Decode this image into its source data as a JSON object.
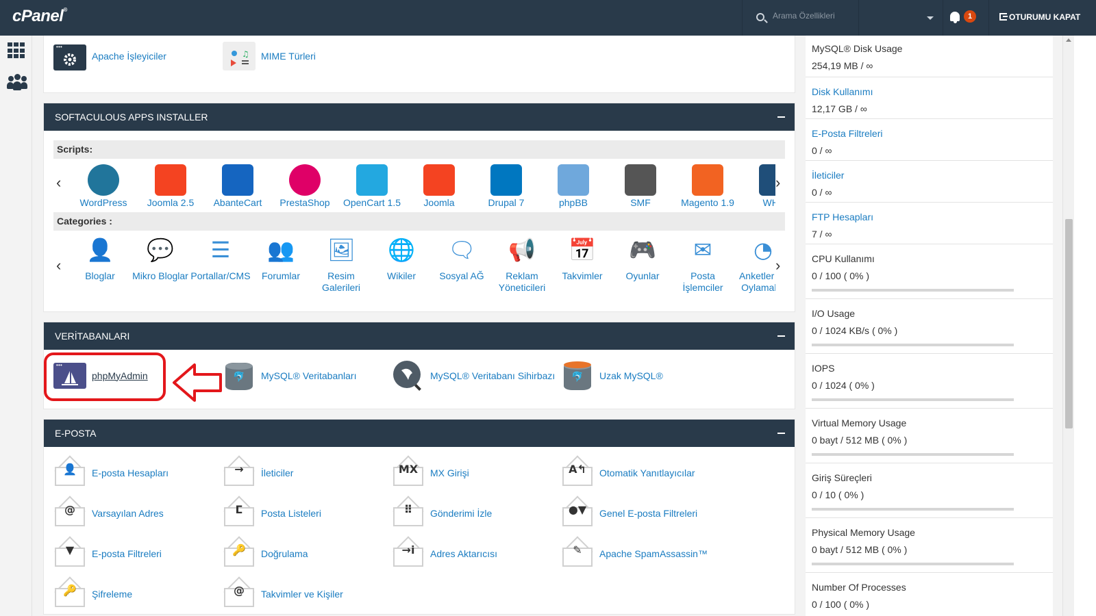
{
  "header": {
    "logo": "cPanel",
    "search_placeholder": "Arama Özellikleri",
    "notifications_count": "1",
    "logout_label": "OTURUMU KAPAT"
  },
  "server_panel": {
    "items": [
      {
        "label": "Apache İşleyiciler",
        "icon": "gear-window-icon"
      },
      {
        "label": "MIME Türleri",
        "icon": "mime-types-icon"
      }
    ]
  },
  "softaculous": {
    "title": "SOFTACULOUS APPS INSTALLER",
    "scripts_label": "Scripts:",
    "scripts": [
      {
        "name": "WordPress",
        "color": "#21759b"
      },
      {
        "name": "Joomla 2.5",
        "color": "#f44321"
      },
      {
        "name": "AbanteCart",
        "color": "#1565c0"
      },
      {
        "name": "PrestaShop",
        "color": "#df0067"
      },
      {
        "name": "OpenCart 1.5",
        "color": "#23a8e0"
      },
      {
        "name": "Joomla",
        "color": "#f44321"
      },
      {
        "name": "Drupal 7",
        "color": "#0077c0"
      },
      {
        "name": "phpBB",
        "color": "#6fa8dc"
      },
      {
        "name": "SMF",
        "color": "#555555"
      },
      {
        "name": "Magento 1.9",
        "color": "#f26322"
      },
      {
        "name": "WHM",
        "color": "#1f4e79"
      }
    ],
    "categories_label": "Categories :",
    "categories": [
      {
        "name": "Bloglar",
        "icon": "user-icon"
      },
      {
        "name": "Mikro Bloglar",
        "icon": "chat-icon"
      },
      {
        "name": "Portallar/CMS",
        "icon": "list-icon"
      },
      {
        "name": "Forumlar",
        "icon": "users-icon"
      },
      {
        "name": "Resim Galerileri",
        "icon": "image-icon"
      },
      {
        "name": "Wikiler",
        "icon": "globe-icon"
      },
      {
        "name": "Sosyal AĞ",
        "icon": "comments-icon"
      },
      {
        "name": "Reklam Yöneticileri",
        "icon": "megaphone-icon"
      },
      {
        "name": "Takvimler",
        "icon": "calendar-icon"
      },
      {
        "name": "Oyunlar",
        "icon": "gamepad-icon"
      },
      {
        "name": "Posta İşlemciler",
        "icon": "envelope-icon"
      },
      {
        "name": "Anketler ve Oylamalar",
        "icon": "pie-chart-icon"
      }
    ]
  },
  "databases": {
    "title": "VERİTABANLARI",
    "items": [
      {
        "label": "phpMyAdmin",
        "icon": "phpmyadmin-icon"
      },
      {
        "label": "MySQL® Veritabanları",
        "icon": "mysql-database-icon"
      },
      {
        "label": "MySQL® Veritabanı Sihirbazı",
        "icon": "mysql-wizard-icon"
      },
      {
        "label": "Uzak MySQL®",
        "icon": "remote-mysql-icon"
      }
    ]
  },
  "email": {
    "title": "E-POSTA",
    "items": [
      {
        "label": "E-posta Hesapları",
        "glyph": "👤"
      },
      {
        "label": "İleticiler",
        "glyph": "→"
      },
      {
        "label": "MX Girişi",
        "glyph": "MX"
      },
      {
        "label": "Otomatik Yanıtlayıcılar",
        "glyph": "A↰"
      },
      {
        "label": "Varsayılan Adres",
        "glyph": "@"
      },
      {
        "label": "Posta Listeleri",
        "glyph": "ⵎ"
      },
      {
        "label": "Gönderimi İzle",
        "glyph": "⠿"
      },
      {
        "label": "Genel E-posta Filtreleri",
        "glyph": "●▼"
      },
      {
        "label": "E-posta Filtreleri",
        "glyph": "▼"
      },
      {
        "label": "Doğrulama",
        "glyph": "🔑"
      },
      {
        "label": "Adres Aktarıcısı",
        "glyph": "→i"
      },
      {
        "label": "Apache SpamAssassin™",
        "glyph": "✎"
      },
      {
        "label": "Şifreleme",
        "glyph": "🔑"
      },
      {
        "label": "Takvimler ve Kişiler",
        "glyph": "@"
      }
    ]
  },
  "stats": [
    {
      "label": "MySQL® Disk Usage",
      "value": "254,19 MB / ∞",
      "link": false
    },
    {
      "label": "Disk Kullanımı",
      "value": "12,17 GB / ∞",
      "link": true
    },
    {
      "label": "E-Posta Filtreleri",
      "value": "0 / ∞",
      "link": true
    },
    {
      "label": "İleticiler",
      "value": "0 / ∞",
      "link": true
    },
    {
      "label": "FTP Hesapları",
      "value": "7 / ∞",
      "link": true
    },
    {
      "label": "CPU Kullanımı",
      "value": "0 / 100 ( 0% )",
      "link": false,
      "percent": 0
    },
    {
      "label": "I/O Usage",
      "value": "0 / 1024 KB/s ( 0% )",
      "link": false,
      "percent": 0
    },
    {
      "label": "IOPS",
      "value": "0 / 1024 ( 0% )",
      "link": false,
      "percent": 0
    },
    {
      "label": "Virtual Memory Usage",
      "value": "0 bayt / 512 MB ( 0% )",
      "link": false,
      "percent": 0
    },
    {
      "label": "Giriş Süreçleri",
      "value": "0 / 10 ( 0% )",
      "link": false,
      "percent": 0
    },
    {
      "label": "Physical Memory Usage",
      "value": "0 bayt / 512 MB ( 0% )",
      "link": false,
      "percent": 0
    },
    {
      "label": "Number Of Processes",
      "value": "0 / 100 ( 0% )",
      "link": false,
      "percent": 0
    }
  ],
  "colors": {
    "header_bg": "#293a4a",
    "link": "#1a7cc1",
    "highlight": "#e3171b",
    "badge": "#d9480f"
  }
}
